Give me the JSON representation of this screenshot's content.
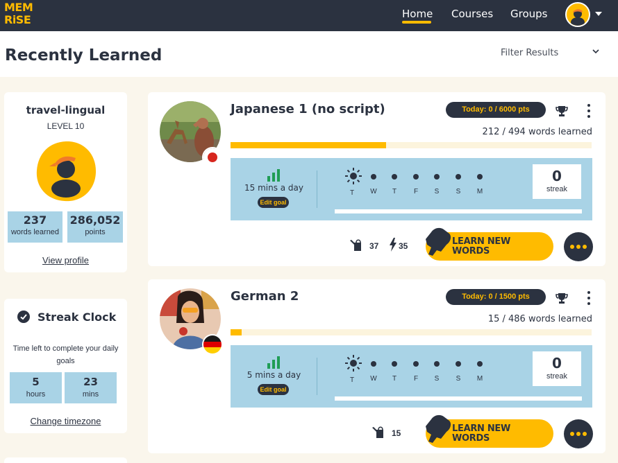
{
  "nav": {
    "logo_line1": "MEM",
    "logo_line2": "RiSE",
    "home": "Home",
    "courses": "Courses",
    "groups": "Groups"
  },
  "header": {
    "title": "Recently Learned",
    "filter": "Filter Results"
  },
  "profile": {
    "username": "travel-lingual",
    "level": "LEVEL 10",
    "words_learned_value": "237",
    "words_learned_label": "words learned",
    "points_value": "286,052",
    "points_label": "points",
    "view_profile": "View profile"
  },
  "streak_clock": {
    "title": "Streak Clock",
    "description": "Time left to complete your daily goals",
    "hours_value": "5",
    "hours_label": "hours",
    "mins_value": "23",
    "mins_label": "mins",
    "change_timezone": "Change timezone"
  },
  "courses": [
    {
      "title": "Japanese 1 (no script)",
      "today": "Today: 0 / 6000 pts",
      "words": "212 / 494 words learned",
      "progress": 0.43,
      "goal": "15 mins a day",
      "edit_goal": "Edit goal",
      "days": [
        "T",
        "W",
        "T",
        "F",
        "S",
        "S",
        "M"
      ],
      "streak_value": "0",
      "streak_label": "streak",
      "water_count": "37",
      "bolt_count": "35",
      "learn_line1": "LEARN NEW",
      "learn_line2": "WORDS"
    },
    {
      "title": "German 2",
      "today": "Today: 0 / 1500 pts",
      "words": "15 / 486 words learned",
      "progress": 0.03,
      "goal": "5 mins a day",
      "edit_goal": "Edit goal",
      "days": [
        "T",
        "W",
        "T",
        "F",
        "S",
        "S",
        "M"
      ],
      "streak_value": "0",
      "streak_label": "streak",
      "water_count": "15",
      "learn_line1": "LEARN NEW",
      "learn_line2": "WORDS"
    }
  ],
  "colors": {
    "navy": "#2b3240",
    "yellow": "#ffbb00",
    "light_blue": "#a9d3e6",
    "cream": "#faf6ec"
  },
  "icons": [
    "sun-icon",
    "trophy-icon",
    "kebab-icon",
    "watering-can-icon",
    "bolt-icon",
    "hand-icon",
    "check-circle-icon",
    "signal-bars-icon",
    "chevron-down-icon"
  ]
}
